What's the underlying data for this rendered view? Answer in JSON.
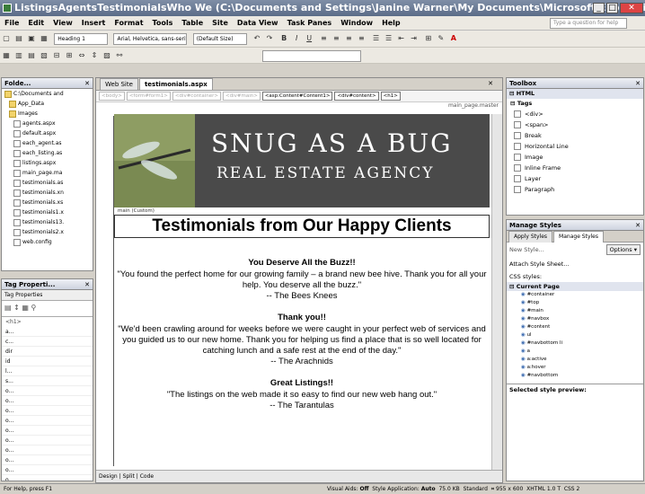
{
  "window": {
    "title": "ListingsAgentsTestimonialsWho We (C:\\Documents and Settings\\Janine Warner\\My Documents\\Microsoft Expression Web\\..."
  },
  "menu": [
    "File",
    "Edit",
    "View",
    "Insert",
    "Format",
    "Tools",
    "Table",
    "Site",
    "Data View",
    "Task Panes",
    "Window",
    "Help"
  ],
  "help_placeholder": "Type a question for help",
  "toolbar": {
    "style": "Heading 1",
    "font": "Arial, Helvetica, sans-serif",
    "size": "(Default Size)"
  },
  "folder_panel": {
    "title": "Folde...",
    "items": [
      "C:\\Documents and",
      "App_Data",
      "Images",
      "agents.aspx",
      "default.aspx",
      "each_agent.as",
      "each_listing.as",
      "listings.aspx",
      "main_page.ma",
      "testimonials.as",
      "testimonials.xn",
      "testimonials.xs",
      "testimonials1.x",
      "testimonials13.",
      "testimonials2.x",
      "web.config"
    ]
  },
  "tag_panel": {
    "title": "Tag Properti...",
    "tab": "Tag Properties",
    "tag": "<h1>",
    "rows": [
      "a...",
      "c...",
      "dir",
      "id",
      "l...",
      "s...",
      "o...",
      "o...",
      "o...",
      "o...",
      "o...",
      "o...",
      "o...",
      "o...",
      "o...",
      "o..."
    ]
  },
  "editor": {
    "tabs": [
      "Web Site",
      "testimonials.aspx"
    ],
    "crumbs": [
      "<body>",
      "<form#form1>",
      "<div#container>",
      "<div#main>",
      "<asp:Content#Content1>",
      "<div#content>",
      "<h1>"
    ],
    "master_label": "main_page.master",
    "region_label": "main (Custom)",
    "view_buttons": [
      "Design",
      "Split",
      "Code"
    ]
  },
  "page": {
    "brand_line1": "SNUG AS A BUG",
    "brand_line2": "REAL ESTATE AGENCY",
    "heading": "Testimonials from Our Happy Clients",
    "testimonials": [
      {
        "title": "You Deserve All the Buzz!!",
        "text": "\"You found the perfect home for our growing family – a brand new bee hive. Thank you for all your help. You deserve all the buzz.\"",
        "author": "-- The Bees Knees"
      },
      {
        "title": "Thank you!!",
        "text": "\"We'd been crawling around for weeks before we were caught in your perfect web of services and you guided us to our new home. Thank you for helping us find a place that is so well located for catching lunch and a safe rest at the end of the day.\"",
        "author": "-- The Arachnids"
      },
      {
        "title": "Great Listings!!",
        "text": "\"The listings on the web made it so easy to find our new web hang out.\"",
        "author": "-- The Tarantulas"
      }
    ]
  },
  "toolbox": {
    "title": "Toolbox",
    "section": "HTML",
    "group": "Tags",
    "items": [
      "<div>",
      "<span>",
      "Break",
      "Horizontal Line",
      "Image",
      "Inline Frame",
      "Layer",
      "Paragraph"
    ]
  },
  "styles_panel": {
    "title": "Manage Styles",
    "tabs": [
      "Apply Styles",
      "Manage Styles"
    ],
    "new_style": "New Style...",
    "options": "Options",
    "attach": "Attach Style Sheet...",
    "css_label": "CSS styles:",
    "group": "Current Page",
    "styles": [
      "#container",
      "#top",
      "#main",
      "#navbox",
      "#content",
      "ul",
      "#navbottom li",
      "a",
      "a:active",
      "a:hover",
      "#navbottom"
    ],
    "preview_label": "Selected style preview:"
  },
  "status": {
    "help": "For Help, press F1",
    "visual_aids_label": "Visual Aids:",
    "visual_aids_value": "Off",
    "style_app_label": "Style Application:",
    "style_app_value": "Auto",
    "size": "75.0 KB",
    "mode": "Standard",
    "dims": "955 x 600",
    "doctype": "XHTML 1.0 T",
    "css": "CSS 2"
  }
}
